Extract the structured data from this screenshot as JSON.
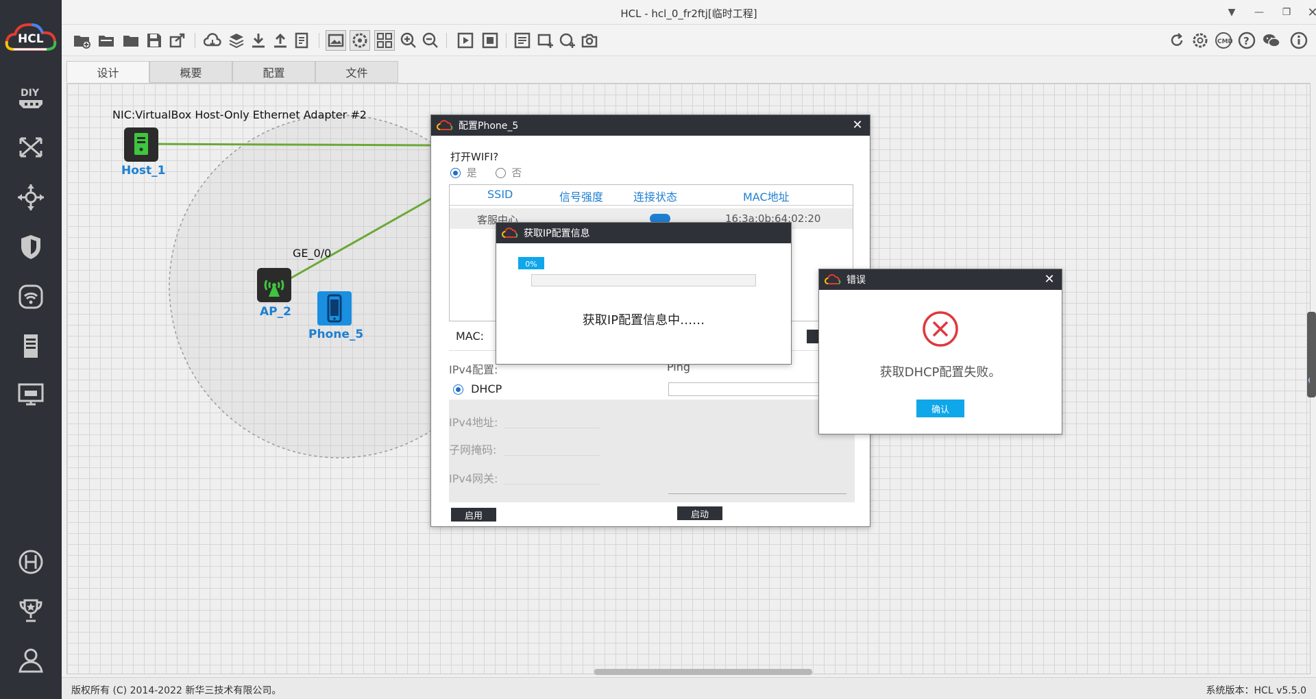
{
  "window": {
    "title": "HCL - hcl_0_fr2ftj[临时工程]",
    "logo_text": "HCL"
  },
  "tabs": [
    "设计",
    "概要",
    "配置",
    "文件"
  ],
  "sidebar": [
    "diy-icon",
    "topology-icon",
    "move-icon",
    "shield-icon",
    "wifi-device-icon",
    "server-icon",
    "monitor-icon",
    "h3c-icon",
    "trophy-icon",
    "user-icon"
  ],
  "canvas": {
    "nic_label": "NIC:VirtualBox Host-Only Ethernet Adapter #2",
    "host_label": "Host_1",
    "ap_label": "AP_2",
    "phone_label": "Phone_5",
    "interface_label": "GE_0/0"
  },
  "config_dialog": {
    "title": "配置Phone_5",
    "wifi_question": "打开WIFI?",
    "yes": "是",
    "no": "否",
    "wifi_on": true,
    "columns": [
      "SSID",
      "信号强度",
      "连接状态",
      "MAC地址"
    ],
    "row": {
      "ssid": "客服中心",
      "mac": "16:3a:0b:64:02:20"
    },
    "mac_label": "MAC:",
    "ipv4_config_label": "IPv4配置:",
    "dhcp_label": "DHCP",
    "ipv4_address_label": "IPv4地址:",
    "subnet_mask_label": "子网掩码:",
    "ipv4_gateway_label": "IPv4网关:",
    "enable_button": "启用",
    "ping_label": "Ping",
    "start_button": "启动"
  },
  "progress_dialog": {
    "title": "获取IP配置信息",
    "percent_text": "0%",
    "progress": 0,
    "message": "获取IP配置信息中……"
  },
  "error_dialog": {
    "title": "错误",
    "message": "获取DHCP配置失败。",
    "confirm_button": "确认"
  },
  "status": {
    "copyright": "版权所有 (C) 2014-2022 新华三技术有限公司。",
    "version": "系统版本：HCL v5.5.0"
  },
  "colors": {
    "sidebar_bg": "#2e3138",
    "accent_blue": "#1e7fd1",
    "link_green": "#6aa935",
    "error_red": "#e0383e",
    "button_blue": "#0fa7ea"
  }
}
